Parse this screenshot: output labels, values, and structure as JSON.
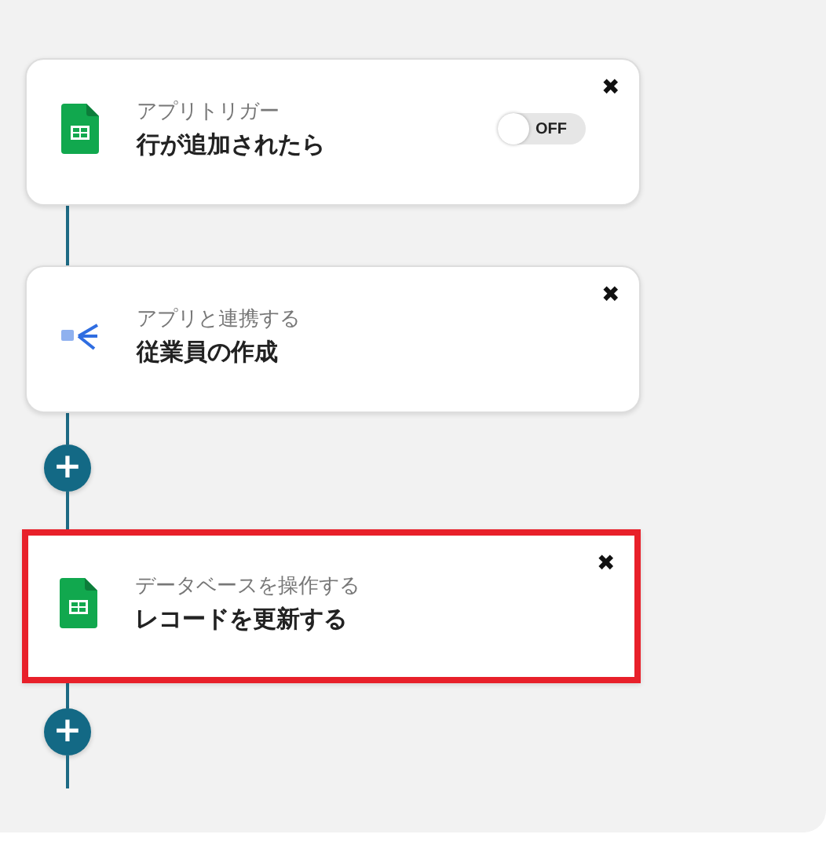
{
  "flow": [
    {
      "kind": "sheet-card",
      "subtitle": "アプリトリガー",
      "title": "行が追加されたら",
      "close": "✖",
      "toggle": {
        "label": "OFF",
        "on": false
      },
      "selected": false
    },
    {
      "kind": "app-card",
      "subtitle": "アプリと連携する",
      "title": "従業員の作成",
      "close": "✖",
      "selected": false
    },
    {
      "kind": "add",
      "label": "+"
    },
    {
      "kind": "sheet-card",
      "subtitle": "データベースを操作する",
      "title": "レコードを更新する",
      "close": "✖",
      "selected": true
    },
    {
      "kind": "add",
      "label": "+"
    }
  ]
}
